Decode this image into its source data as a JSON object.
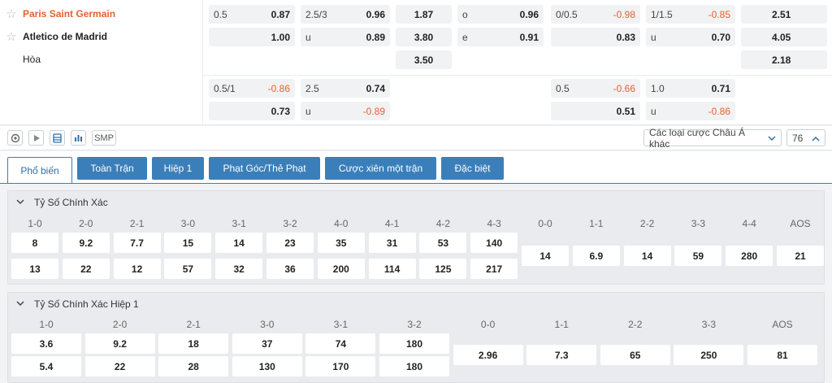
{
  "teams": {
    "home": "Paris Saint Germain",
    "away": "Atletico de Madrid",
    "draw": "Hòa"
  },
  "odds": {
    "ft_hdp": {
      "line1": "0.5",
      "home": "0.87",
      "away": "1.00"
    },
    "ft_ou": {
      "line": "2.5/3",
      "over": "0.96",
      "under_label": "u",
      "under": "0.89"
    },
    "ft_1x2": {
      "home": "1.87",
      "away": "3.80",
      "draw": "3.50"
    },
    "ft_oe": {
      "o_label": "o",
      "odd": "0.96",
      "e_label": "e",
      "even": "0.91"
    },
    "h1_hdp": {
      "line": "0/0.5",
      "home": "-0.98",
      "away": "0.83"
    },
    "h1_ou": {
      "line": "1/1.5",
      "over": "-0.85",
      "under_label": "u",
      "under": "0.70"
    },
    "h1_1x2": {
      "home": "2.51",
      "away": "4.05",
      "draw": "2.18"
    },
    "ft_hdp2": {
      "line": "0.5/1",
      "home": "-0.86",
      "away": "0.73"
    },
    "ft_ou2": {
      "line": "2.5",
      "over": "0.74",
      "under_label": "u",
      "under": "-0.89"
    },
    "h1_hdp2": {
      "line": "0.5",
      "home": "-0.66",
      "away": "0.51"
    },
    "h1_ou2": {
      "line": "1.0",
      "over": "0.71",
      "under_label": "u",
      "under": "-0.86"
    }
  },
  "toolbar": {
    "smp_label": "SMP",
    "market_select": "Các loại cược Châu Á khác",
    "count": "76"
  },
  "tabs": [
    "Phổ biến",
    "Toàn Trận",
    "Hiệp 1",
    "Phạt Góc/Thẻ Phạt",
    "Cược xiên một trận",
    "Đặc biệt"
  ],
  "cs_ft": {
    "title": "Tỷ Số Chính Xác",
    "home_cols": [
      {
        "h": "1-0",
        "a": "8",
        "b": "13"
      },
      {
        "h": "2-0",
        "a": "9.2",
        "b": "22"
      },
      {
        "h": "2-1",
        "a": "7.7",
        "b": "12"
      },
      {
        "h": "3-0",
        "a": "15",
        "b": "57"
      },
      {
        "h": "3-1",
        "a": "14",
        "b": "32"
      },
      {
        "h": "3-2",
        "a": "23",
        "b": "36"
      },
      {
        "h": "4-0",
        "a": "35",
        "b": "200"
      },
      {
        "h": "4-1",
        "a": "31",
        "b": "114"
      },
      {
        "h": "4-2",
        "a": "53",
        "b": "125"
      },
      {
        "h": "4-3",
        "a": "140",
        "b": "217"
      }
    ],
    "draw_cols": [
      {
        "h": "0-0",
        "v": "14"
      },
      {
        "h": "1-1",
        "v": "6.9"
      },
      {
        "h": "2-2",
        "v": "14"
      },
      {
        "h": "3-3",
        "v": "59"
      },
      {
        "h": "4-4",
        "v": "280"
      },
      {
        "h": "AOS",
        "v": "21"
      }
    ]
  },
  "cs_h1": {
    "title": "Tỷ Số Chính Xác Hiệp 1",
    "home_cols": [
      {
        "h": "1-0",
        "a": "3.6",
        "b": "5.4"
      },
      {
        "h": "2-0",
        "a": "9.2",
        "b": "22"
      },
      {
        "h": "2-1",
        "a": "18",
        "b": "28"
      },
      {
        "h": "3-0",
        "a": "37",
        "b": "130"
      },
      {
        "h": "3-1",
        "a": "74",
        "b": "170"
      },
      {
        "h": "3-2",
        "a": "180",
        "b": "180"
      }
    ],
    "draw_cols": [
      {
        "h": "0-0",
        "v": "2.96"
      },
      {
        "h": "1-1",
        "v": "7.3"
      },
      {
        "h": "2-2",
        "v": "65"
      },
      {
        "h": "3-3",
        "v": "250"
      },
      {
        "h": "AOS",
        "v": "81"
      }
    ]
  },
  "colors": {
    "accent": "#3a7fb9",
    "negative": "#e8602c",
    "home_team": "#e8602c"
  }
}
